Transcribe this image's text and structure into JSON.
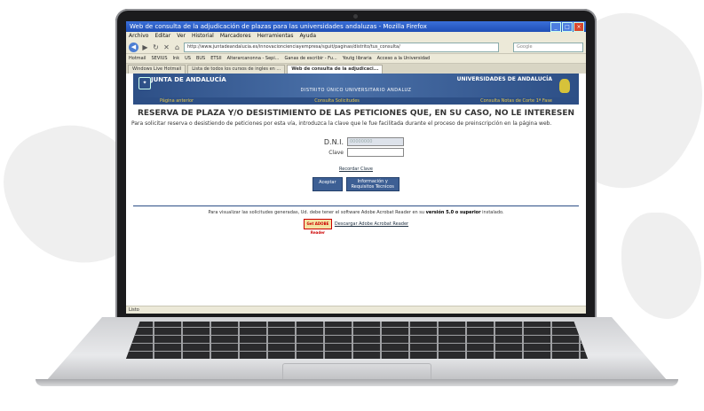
{
  "browser": {
    "window_title": "Web de consulta de la adjudicación de plazas para las universidades andaluzas - Mozilla Firefox",
    "menu": [
      "Archivo",
      "Editar",
      "Ver",
      "Historial",
      "Marcadores",
      "Herramientas",
      "Ayuda"
    ],
    "url": "http://www.juntadeandalucia.es/innovacioncienciayempresa/sguit/paginas/distrito/tus_consulta/",
    "search_placeholder": "Google",
    "bookmarks": [
      "Hotmail",
      "SEVIUS",
      "Ink",
      "US",
      "BUS",
      "ETSII",
      "Alterarcanonna - Sepi...",
      "Ganas de escribir - Fu...",
      "Youtg libraria",
      "Acceso a la Universidad"
    ],
    "tabs": [
      {
        "label": "Windows Live Hotmail",
        "active": false
      },
      {
        "label": "Lista de todos los cursos de ingles en ...",
        "active": false
      },
      {
        "label": "Web de consulta de la adjudicaci...",
        "active": true
      }
    ]
  },
  "header": {
    "junta": "JUNTA DE ANDALUCÍA",
    "universidades": "UNIVERSIDADES DE ANDALUCÍA",
    "distrito": "DISTRITO ÚNICO UNIVERSITARIO ANDALUZ",
    "nav": [
      "Página anterior",
      "Consulta Solicitudes",
      "Consulta Notas de Corte 1ª Fase"
    ]
  },
  "main": {
    "title": "RESERVA DE PLAZA Y/O DESISTIMIENTO DE LAS PETICIONES QUE, EN SU CASO, NO LE INTERESEN",
    "intro": "Para solicitar reserva o desistiendo de peticiones por esta vía, introduzca la clave que le fue facilitada durante el proceso de preinscripción en la página web.",
    "dni_label": "D.N.I.",
    "dni_value": "00000000",
    "clave_label": "Clave",
    "recover_link": "Recordar Clave",
    "accept_button": "Aceptar",
    "info_button_line1": "Información y",
    "info_button_line2": "Requisitos Técnicos"
  },
  "footer": {
    "note_prefix": "Para visualizar las solicitudes generadas, Ud. debe tener el software Adobe Acrobat Reader en su",
    "note_bold": "versión 5.0 o superior",
    "note_suffix": "instalado.",
    "adobe_badge": "Get ADOBE Reader",
    "download_link": "Descargar Adobe Acrobat Reader"
  },
  "status": "Listo"
}
